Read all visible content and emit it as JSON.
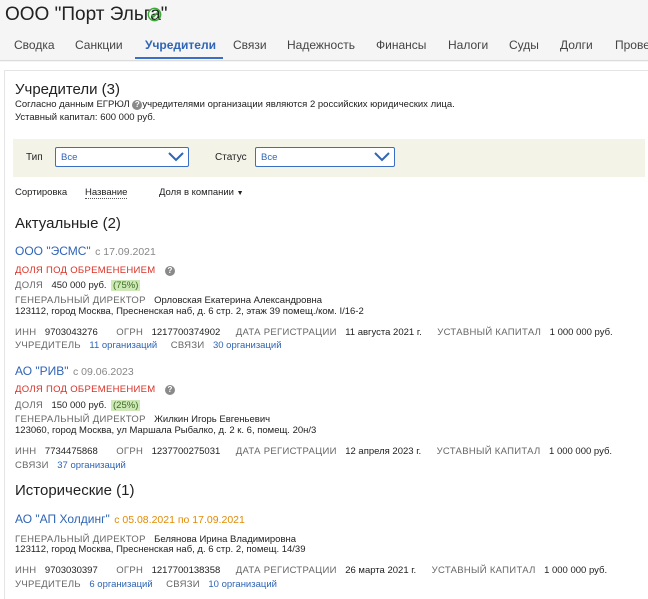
{
  "company": {
    "title": "ООО \"Порт Эльга\""
  },
  "tabs": [
    "Сводка",
    "Санкции",
    "Учредители",
    "Связи",
    "Надежность",
    "Финансы",
    "Налоги",
    "Суды",
    "Долги",
    "Прове"
  ],
  "founders": {
    "title": "Учредители (3)",
    "desc_pre": "Согласно данным ЕГРЮЛ",
    "desc_post": "учредителями организации являются 2 российских юридических лица.",
    "capital": "Уставный капитал: 600 000 руб.",
    "filters": {
      "type_label": "Тип",
      "type_value": "Все",
      "status_label": "Статус",
      "status_value": "Все"
    },
    "sort": {
      "label": "Сортировка",
      "by_name": "Название",
      "by_share": "Доля в компании"
    }
  },
  "labels": {
    "share": "ДОЛЯ",
    "director": "ГЕНЕРАЛЬНЫЙ ДИРЕКТОР",
    "inn": "ИНН",
    "ogrn": "ОГРН",
    "reg_date": "ДАТА РЕГИСТРАЦИИ",
    "capital": "УСТАВНЫЙ КАПИТАЛ",
    "founder": "УЧРЕДИТЕЛЬ",
    "links": "СВЯЗИ",
    "burden": "ДОЛЯ ПОД ОБРЕМЕНЕНИЕМ"
  },
  "current": {
    "title": "Актуальные (2)",
    "items": [
      {
        "name": "ООО \"ЭСМС\"",
        "since": "с 17.09.2021",
        "share_value": "450 000 руб.",
        "share_pct": "(75%)",
        "director": "Орловская Екатерина Александровна",
        "address": "123112, город Москва, Пресненская наб, д. 6 стр. 2, этаж 39 помещ./ком. I/16-2",
        "inn": "9703043276",
        "ogrn": "1217700374902",
        "reg_date": "11 августа 2021 г.",
        "capital": "1 000 000 руб.",
        "founder_link": "11 организаций",
        "links_link": "30 организаций"
      },
      {
        "name": "АО \"РИВ\"",
        "since": "с 09.06.2023",
        "share_value": "150 000 руб.",
        "share_pct": "(25%)",
        "director": "Жилкин Игорь Евгеньевич",
        "address": "123060, город Москва, ул Маршала Рыбалко, д. 2 к. 6, помещ. 20н/3",
        "inn": "7734475868",
        "ogrn": "1237700275031",
        "reg_date": "12 апреля 2023 г.",
        "capital": "1 000 000 руб.",
        "links_link": "37 организаций"
      }
    ]
  },
  "historic": {
    "title": "Исторические (1)",
    "items": [
      {
        "name": "АО \"АП Холдинг\"",
        "range": "с 05.08.2021 по 17.09.2021",
        "director": "Белянова Ирина Владимировна",
        "address": "123112, город Москва, Пресненская наб, д. 6 стр. 2, помещ. 14/39",
        "inn": "9703030397",
        "ogrn": "1217700138358",
        "reg_date": "26 марта 2021 г.",
        "capital": "1 000 000 руб.",
        "founder_link": "6 организаций",
        "links_link": "10 организаций"
      }
    ]
  },
  "colors": {
    "accent": "#2f64b6",
    "warning": "#d93025",
    "historic": "#e28a00",
    "verified": "#3aaa35"
  }
}
